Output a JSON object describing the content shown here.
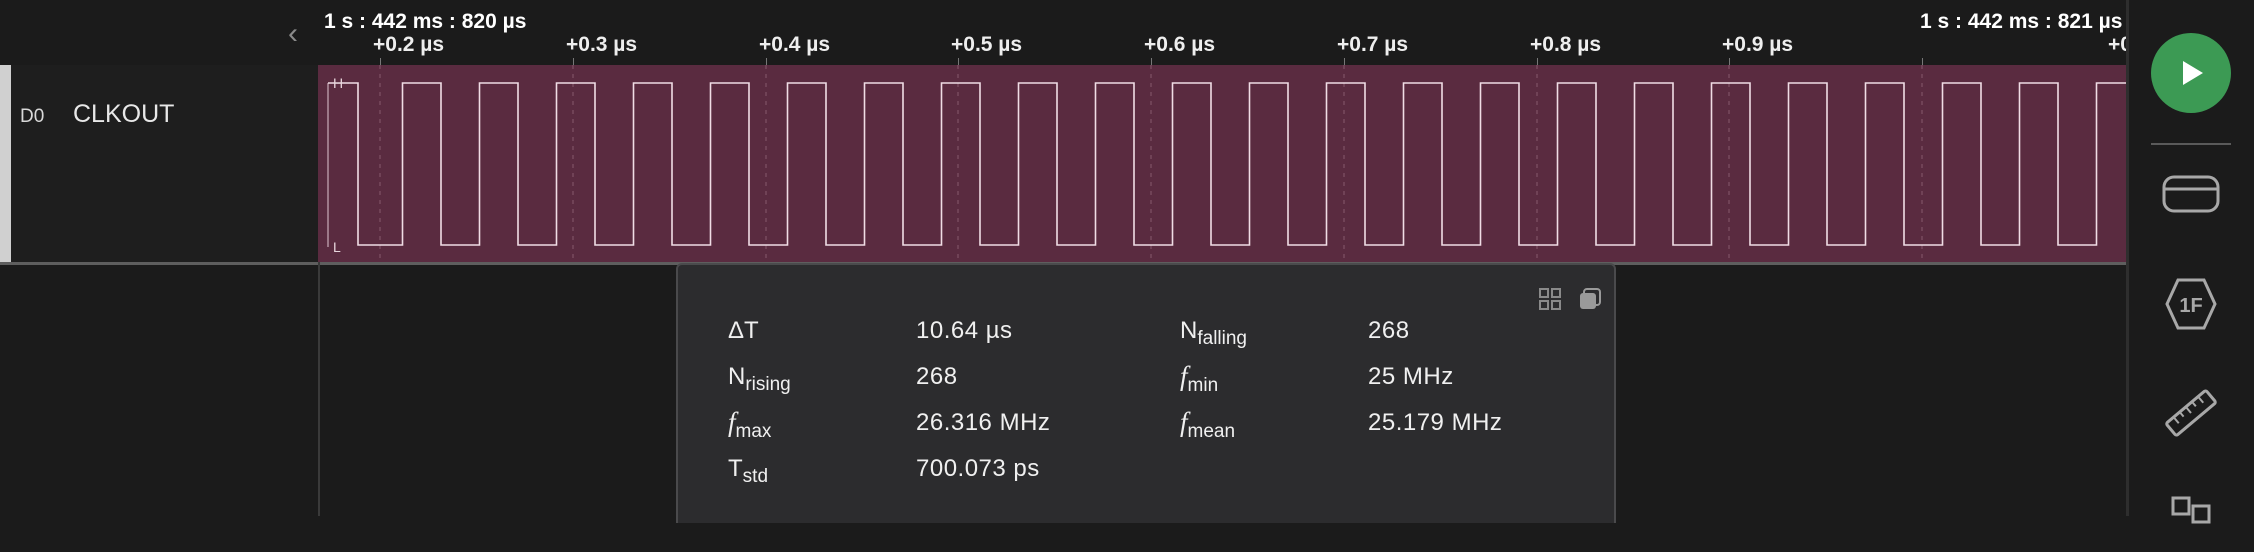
{
  "ruler": {
    "start_marker": "1 s : 442 ms : 820 µs",
    "end_marker": "1 s : 442 ms : 821 µs",
    "ticks": [
      "+0.2 µs",
      "+0.3 µs",
      "+0.4 µs",
      "+0.5 µs",
      "+0.6 µs",
      "+0.7 µs",
      "+0.8 µs",
      "+0.9 µs",
      "+0"
    ]
  },
  "channel": {
    "index": "D0",
    "name": "CLKOUT",
    "high_label": "H",
    "low_label": "L",
    "color": "#5a2b40"
  },
  "measurements": {
    "rows": [
      {
        "label_main": "ΔT",
        "label_sub": "",
        "italic": false,
        "value": "10.64 µs"
      },
      {
        "label_main": "N",
        "label_sub": "falling",
        "italic": false,
        "value": "268"
      },
      {
        "label_main": "N",
        "label_sub": "rising",
        "italic": false,
        "value": "268"
      },
      {
        "label_main": "f",
        "label_sub": "min",
        "italic": true,
        "value": "25 MHz"
      },
      {
        "label_main": "f",
        "label_sub": "max",
        "italic": true,
        "value": "26.316 MHz"
      },
      {
        "label_main": "f",
        "label_sub": "mean",
        "italic": true,
        "value": "25.179 MHz"
      },
      {
        "label_main": "T",
        "label_sub": "std",
        "italic": false,
        "value": "700.073 ps"
      }
    ]
  },
  "sidebar": {
    "play_color": "#3c9a54",
    "icons": [
      "play-icon",
      "device-icon",
      "protocol-analyzer-icon",
      "measure-ruler-icon",
      "extensions-icon"
    ]
  }
}
